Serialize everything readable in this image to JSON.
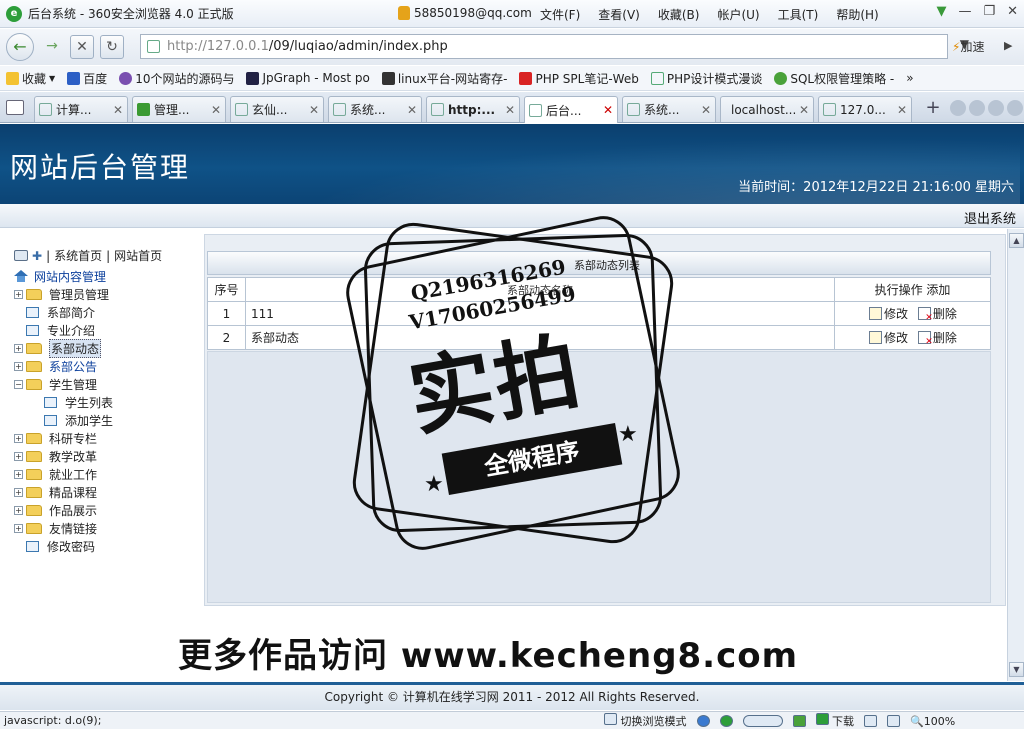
{
  "browser": {
    "window_title": "后台系统 - 360安全浏览器 4.0 正式版",
    "account": "58850198@qq.com",
    "menu": [
      "文件(F)",
      "查看(V)",
      "收藏(B)",
      "帐户(U)",
      "工具(T)",
      "帮助(H)"
    ],
    "address_prefix": "http://127.0.0.1",
    "address_rest": "/09/luqiao/admin/index.php",
    "accelerate": "加速",
    "favorites": [
      "收藏",
      "百度",
      "10个网站的源码与",
      "JpGraph - Most po",
      "linux平台-网站寄存-",
      "PHP SPL笔记-Web",
      "PHP设计模式漫谈",
      "SQL权限管理策略 -"
    ],
    "favorites_more": "»",
    "tabs": [
      "计算...",
      "管理...",
      "玄仙...",
      "系统...",
      "http:...",
      "后台...",
      "系统...",
      "localhost...",
      "127.0..."
    ],
    "active_tab_index": 5,
    "status_text": "javascript: d.o(9);",
    "status_right": [
      "切换浏览模式",
      "下载",
      "100%"
    ]
  },
  "header": {
    "site_title": "网站后台管理",
    "current_time": "当前时间：2012年12月22日  21:16:00 星期六",
    "logout": "退出系统"
  },
  "sidebar": {
    "quick_links": [
      "系统首页",
      "网站首页"
    ],
    "tree": [
      {
        "label": "网站内容管理",
        "type": "root"
      },
      {
        "label": "管理员管理",
        "type": "folder"
      },
      {
        "label": "系部简介",
        "type": "doc"
      },
      {
        "label": "专业介绍",
        "type": "doc"
      },
      {
        "label": "系部动态",
        "type": "folder",
        "selected": true
      },
      {
        "label": "系部公告",
        "type": "folder",
        "blue": true
      },
      {
        "label": "学生管理",
        "type": "folder-open"
      },
      {
        "label": "学生列表",
        "type": "doc-child"
      },
      {
        "label": "添加学生",
        "type": "doc-child"
      },
      {
        "label": "科研专栏",
        "type": "folder"
      },
      {
        "label": "教学改革",
        "type": "folder"
      },
      {
        "label": "就业工作",
        "type": "folder"
      },
      {
        "label": "精品课程",
        "type": "folder"
      },
      {
        "label": "作品展示",
        "type": "folder"
      },
      {
        "label": "友情链接",
        "type": "folder"
      },
      {
        "label": "修改密码",
        "type": "doc"
      }
    ]
  },
  "main": {
    "list_title": "系部动态列表",
    "columns": {
      "no": "序号",
      "name": "系部动态名称",
      "action": "执行操作",
      "add": "添加"
    },
    "rows": [
      {
        "no": "1",
        "name": "111"
      },
      {
        "no": "2",
        "name": "系部动态"
      }
    ],
    "edit_label": "修改",
    "delete_label": "删除"
  },
  "footer": {
    "copyright": "Copyright © 计算机在线学习网  2011 - 2012 All Rights Reserved."
  },
  "watermark": {
    "qq": "Q2196316269",
    "wechat": "V17060256499",
    "big_text": "实拍",
    "banner": "全微程序",
    "promo": "更多作品访问 www.kecheng8.com"
  }
}
